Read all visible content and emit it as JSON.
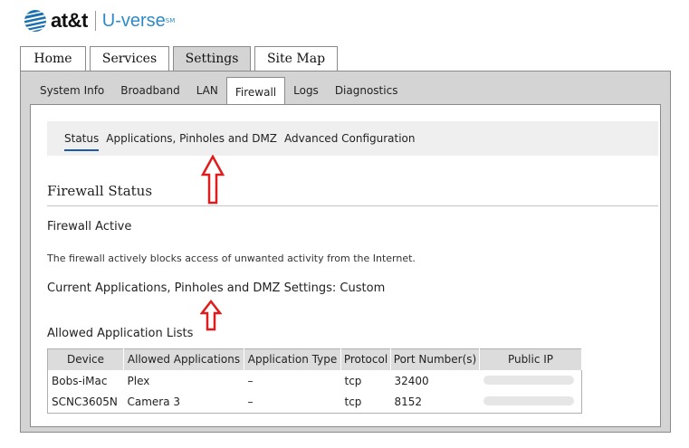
{
  "logo": {
    "brand": "at&t",
    "product": "U-verse",
    "tm": "SM"
  },
  "main_tabs": [
    {
      "label": "Home"
    },
    {
      "label": "Services"
    },
    {
      "label": "Settings"
    },
    {
      "label": "Site Map"
    }
  ],
  "sub_tabs": [
    {
      "label": "System Info"
    },
    {
      "label": "Broadband"
    },
    {
      "label": "LAN"
    },
    {
      "label": "Firewall"
    },
    {
      "label": "Logs"
    },
    {
      "label": "Diagnostics"
    }
  ],
  "firewall_nav": [
    {
      "label": "Status"
    },
    {
      "label": "Applications, Pinholes and DMZ"
    },
    {
      "label": "Advanced Configuration"
    }
  ],
  "section_title": "Firewall Status",
  "firewall_active": "Firewall Active",
  "firewall_description": "The firewall actively blocks access of unwanted activity from the Internet.",
  "current_settings": "Current Applications, Pinholes and DMZ Settings: Custom",
  "allowed_title": "Allowed Application Lists",
  "table": {
    "headers": [
      "Device",
      "Allowed Applications",
      "Application Type",
      "Protocol",
      "Port Number(s)",
      "Public IP"
    ],
    "rows": [
      {
        "device": "Bobs-iMac",
        "app": "Plex",
        "type": "–",
        "protocol": "tcp",
        "port": "32400"
      },
      {
        "device": "SCNC3605N",
        "app": "Camera 3",
        "type": "–",
        "protocol": "tcp",
        "port": "8152"
      }
    ]
  },
  "colors": {
    "accent_blue": "#2c8bc7",
    "active_underline": "#1c5aa6",
    "annotation_arrow": "#e11b1b",
    "panel_gray": "#d4d4d4"
  }
}
